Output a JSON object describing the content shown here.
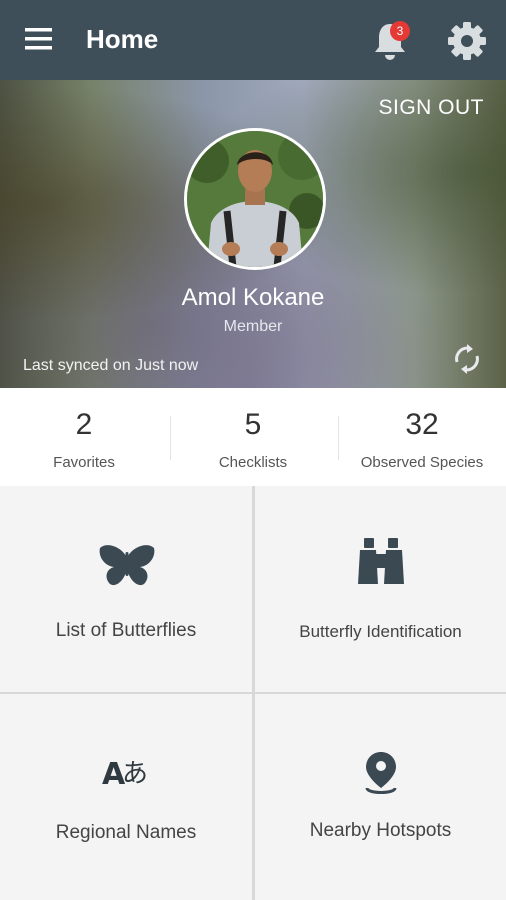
{
  "appbar": {
    "title": "Home",
    "notification_count": "3",
    "icons": [
      "menu-icon",
      "bell-icon",
      "gear-icon"
    ]
  },
  "profile": {
    "sign_out": "SIGN OUT",
    "name": "Amol Kokane",
    "role": "Member",
    "sync_status": "Last synced on Just now"
  },
  "stats": [
    {
      "value": "2",
      "label": "Favorites"
    },
    {
      "value": "5",
      "label": "Checklists"
    },
    {
      "value": "32",
      "label": "Observed Species"
    }
  ],
  "tiles": [
    {
      "label": "List of Butterflies",
      "icon": "butterfly-icon"
    },
    {
      "label": "Butterfly Identification",
      "icon": "binoculars-icon"
    },
    {
      "label": "Regional Names",
      "icon": "translate-icon"
    },
    {
      "label": "Nearby Hotspots",
      "icon": "location-pin-icon"
    }
  ],
  "colors": {
    "appbar": "#3e4f59",
    "icon": "#3b4a52",
    "badge": "#e53935"
  }
}
